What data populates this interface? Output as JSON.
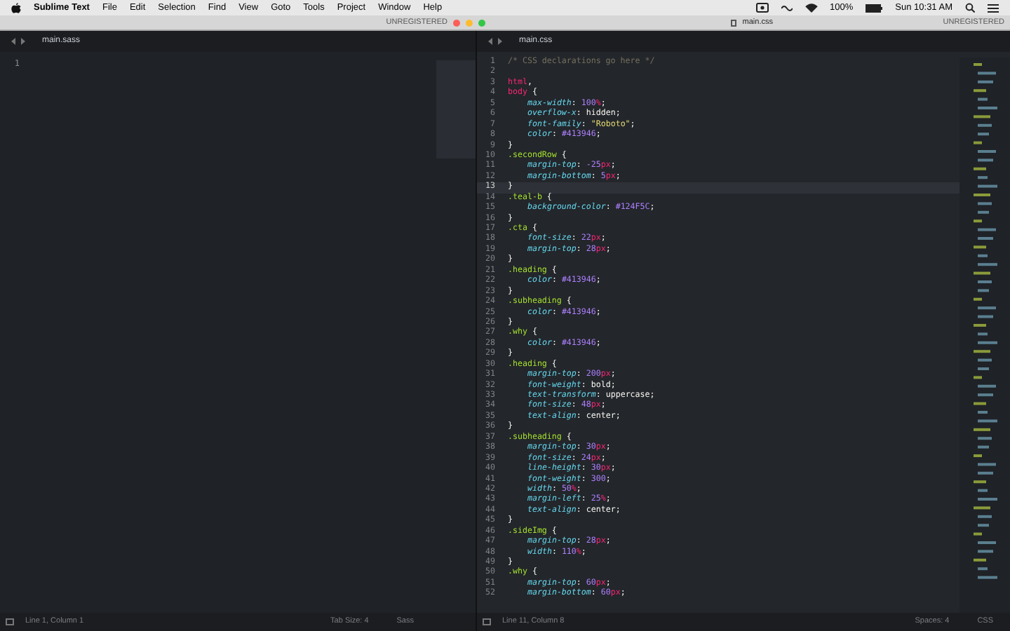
{
  "menu_bar": {
    "app_name": "Sublime Text",
    "menus": [
      "File",
      "Edit",
      "Selection",
      "Find",
      "View",
      "Goto",
      "Tools",
      "Project",
      "Window",
      "Help"
    ],
    "battery": "100%",
    "clock": "Sun 10:31 AM"
  },
  "title_bar": {
    "left_label": "UNREGISTERED",
    "right_title": "main.css",
    "right_label": "UNREGISTERED"
  },
  "left_pane": {
    "tab": "main.sass",
    "line_numbers": [
      "1"
    ],
    "status": {
      "position": "Line 1, Column 1",
      "tab_size": "Tab Size: 4",
      "syntax": "Sass"
    }
  },
  "right_pane": {
    "tab": "main.css",
    "status": {
      "position": "Line 11, Column 8",
      "tab_size": "Spaces: 4",
      "syntax": "CSS"
    },
    "lines": [
      {
        "n": "1",
        "indent": false,
        "current": false,
        "tokens": [
          {
            "text": "/* CSS declarations go here */",
            "kind": "comment"
          }
        ]
      },
      {
        "n": "2",
        "current": false
      },
      {
        "n": "3",
        "indent": false,
        "current": false,
        "tokens": [
          {
            "text": "html",
            "kind": "tag"
          },
          {
            "text": ",",
            "kind": "plain"
          }
        ]
      },
      {
        "n": "4",
        "indent": false,
        "current": false,
        "tokens": [
          {
            "text": "body",
            "kind": "tag"
          },
          {
            "text": " {",
            "kind": "plain"
          }
        ]
      },
      {
        "n": "5",
        "indent": true,
        "current": false,
        "tokens": [
          {
            "text": "max-width",
            "kind": "prop"
          },
          {
            "text": ": ",
            "kind": "plain"
          },
          {
            "text": "100",
            "kind": "num"
          },
          {
            "text": "%",
            "kind": "unit"
          },
          {
            "text": ";",
            "kind": "plain"
          }
        ]
      },
      {
        "n": "6",
        "indent": true,
        "current": false,
        "tokens": [
          {
            "text": "overflow-x",
            "kind": "prop"
          },
          {
            "text": ": hidden;",
            "kind": "plain"
          }
        ]
      },
      {
        "n": "7",
        "indent": true,
        "current": false,
        "tokens": [
          {
            "text": "font-family",
            "kind": "prop"
          },
          {
            "text": ": ",
            "kind": "plain"
          },
          {
            "text": "\"Roboto\"",
            "kind": "string"
          },
          {
            "text": ";",
            "kind": "plain"
          }
        ]
      },
      {
        "n": "8",
        "indent": true,
        "current": false,
        "tokens": [
          {
            "text": "color",
            "kind": "prop"
          },
          {
            "text": ": ",
            "kind": "plain"
          },
          {
            "text": "#413946",
            "kind": "num"
          },
          {
            "text": ";",
            "kind": "plain"
          }
        ]
      },
      {
        "n": "9",
        "indent": false,
        "current": false,
        "tokens": [
          {
            "text": "}",
            "kind": "plain"
          }
        ]
      },
      {
        "n": "10",
        "indent": false,
        "current": false,
        "tokens": [
          {
            "text": ".secondRow",
            "kind": "selector"
          },
          {
            "text": " {",
            "kind": "plain"
          }
        ]
      },
      {
        "n": "11",
        "indent": true,
        "current": false,
        "tokens": [
          {
            "text": "margin-top",
            "kind": "prop"
          },
          {
            "text": ": ",
            "kind": "plain"
          },
          {
            "text": "-25",
            "kind": "num"
          },
          {
            "text": "px",
            "kind": "unit"
          },
          {
            "text": ";",
            "kind": "plain"
          }
        ]
      },
      {
        "n": "12",
        "indent": true,
        "current": false,
        "tokens": [
          {
            "text": "margin-bottom",
            "kind": "prop"
          },
          {
            "text": ": ",
            "kind": "plain"
          },
          {
            "text": "5",
            "kind": "num"
          },
          {
            "text": "px",
            "kind": "unit"
          },
          {
            "text": ";",
            "kind": "plain"
          }
        ]
      },
      {
        "n": "13",
        "indent": false,
        "current": true,
        "tokens": [
          {
            "text": "}",
            "kind": "plain"
          }
        ]
      },
      {
        "n": "14",
        "indent": false,
        "current": false,
        "tokens": [
          {
            "text": ".teal-b",
            "kind": "selector"
          },
          {
            "text": " {",
            "kind": "plain"
          }
        ]
      },
      {
        "n": "15",
        "indent": true,
        "current": false,
        "tokens": [
          {
            "text": "background-color",
            "kind": "prop"
          },
          {
            "text": ": ",
            "kind": "plain"
          },
          {
            "text": "#124F5C",
            "kind": "num"
          },
          {
            "text": ";",
            "kind": "plain"
          }
        ]
      },
      {
        "n": "16",
        "indent": false,
        "current": false,
        "tokens": [
          {
            "text": "}",
            "kind": "plain"
          }
        ]
      },
      {
        "n": "17",
        "indent": false,
        "current": false,
        "tokens": [
          {
            "text": ".cta",
            "kind": "selector"
          },
          {
            "text": " {",
            "kind": "plain"
          }
        ]
      },
      {
        "n": "18",
        "indent": true,
        "current": false,
        "tokens": [
          {
            "text": "font-size",
            "kind": "prop"
          },
          {
            "text": ": ",
            "kind": "plain"
          },
          {
            "text": "22",
            "kind": "num"
          },
          {
            "text": "px",
            "kind": "unit"
          },
          {
            "text": ";",
            "kind": "plain"
          }
        ]
      },
      {
        "n": "19",
        "indent": true,
        "current": false,
        "tokens": [
          {
            "text": "margin-top",
            "kind": "prop"
          },
          {
            "text": ": ",
            "kind": "plain"
          },
          {
            "text": "28",
            "kind": "num"
          },
          {
            "text": "px",
            "kind": "unit"
          },
          {
            "text": ";",
            "kind": "plain"
          }
        ]
      },
      {
        "n": "20",
        "indent": false,
        "current": false,
        "tokens": [
          {
            "text": "}",
            "kind": "plain"
          }
        ]
      },
      {
        "n": "21",
        "indent": false,
        "current": false,
        "tokens": [
          {
            "text": ".heading",
            "kind": "selector"
          },
          {
            "text": " {",
            "kind": "plain"
          }
        ]
      },
      {
        "n": "22",
        "indent": true,
        "current": false,
        "tokens": [
          {
            "text": "color",
            "kind": "prop"
          },
          {
            "text": ": ",
            "kind": "plain"
          },
          {
            "text": "#413946",
            "kind": "num"
          },
          {
            "text": ";",
            "kind": "plain"
          }
        ]
      },
      {
        "n": "23",
        "indent": false,
        "current": false,
        "tokens": [
          {
            "text": "}",
            "kind": "plain"
          }
        ]
      },
      {
        "n": "24",
        "indent": false,
        "current": false,
        "tokens": [
          {
            "text": ".subheading",
            "kind": "selector"
          },
          {
            "text": " {",
            "kind": "plain"
          }
        ]
      },
      {
        "n": "25",
        "indent": true,
        "current": false,
        "tokens": [
          {
            "text": "color",
            "kind": "prop"
          },
          {
            "text": ": ",
            "kind": "plain"
          },
          {
            "text": "#413946",
            "kind": "num"
          },
          {
            "text": ";",
            "kind": "plain"
          }
        ]
      },
      {
        "n": "26",
        "indent": false,
        "current": false,
        "tokens": [
          {
            "text": "}",
            "kind": "plain"
          }
        ]
      },
      {
        "n": "27",
        "indent": false,
        "current": false,
        "tokens": [
          {
            "text": ".why",
            "kind": "selector"
          },
          {
            "text": " {",
            "kind": "plain"
          }
        ]
      },
      {
        "n": "28",
        "indent": true,
        "current": false,
        "tokens": [
          {
            "text": "color",
            "kind": "prop"
          },
          {
            "text": ": ",
            "kind": "plain"
          },
          {
            "text": "#413946",
            "kind": "num"
          },
          {
            "text": ";",
            "kind": "plain"
          }
        ]
      },
      {
        "n": "29",
        "indent": false,
        "current": false,
        "tokens": [
          {
            "text": "}",
            "kind": "plain"
          }
        ]
      },
      {
        "n": "30",
        "indent": false,
        "current": false,
        "tokens": [
          {
            "text": ".heading",
            "kind": "selector"
          },
          {
            "text": " {",
            "kind": "plain"
          }
        ]
      },
      {
        "n": "31",
        "indent": true,
        "current": false,
        "tokens": [
          {
            "text": "margin-top",
            "kind": "prop"
          },
          {
            "text": ": ",
            "kind": "plain"
          },
          {
            "text": "200",
            "kind": "num"
          },
          {
            "text": "px",
            "kind": "unit"
          },
          {
            "text": ";",
            "kind": "plain"
          }
        ]
      },
      {
        "n": "32",
        "indent": true,
        "current": false,
        "tokens": [
          {
            "text": "font-weight",
            "kind": "prop"
          },
          {
            "text": ": bold;",
            "kind": "plain"
          }
        ]
      },
      {
        "n": "33",
        "indent": true,
        "current": false,
        "tokens": [
          {
            "text": "text-transform",
            "kind": "prop"
          },
          {
            "text": ": uppercase;",
            "kind": "plain"
          }
        ]
      },
      {
        "n": "34",
        "indent": true,
        "current": false,
        "tokens": [
          {
            "text": "font-size",
            "kind": "prop"
          },
          {
            "text": ": ",
            "kind": "plain"
          },
          {
            "text": "48",
            "kind": "num"
          },
          {
            "text": "px",
            "kind": "unit"
          },
          {
            "text": ";",
            "kind": "plain"
          }
        ]
      },
      {
        "n": "35",
        "indent": true,
        "current": false,
        "tokens": [
          {
            "text": "text-align",
            "kind": "prop"
          },
          {
            "text": ": center;",
            "kind": "plain"
          }
        ]
      },
      {
        "n": "36",
        "indent": false,
        "current": false,
        "tokens": [
          {
            "text": "}",
            "kind": "plain"
          }
        ]
      },
      {
        "n": "37",
        "indent": false,
        "current": false,
        "tokens": [
          {
            "text": ".subheading",
            "kind": "selector"
          },
          {
            "text": " {",
            "kind": "plain"
          }
        ]
      },
      {
        "n": "38",
        "indent": true,
        "current": false,
        "tokens": [
          {
            "text": "margin-top",
            "kind": "prop"
          },
          {
            "text": ": ",
            "kind": "plain"
          },
          {
            "text": "30",
            "kind": "num"
          },
          {
            "text": "px",
            "kind": "unit"
          },
          {
            "text": ";",
            "kind": "plain"
          }
        ]
      },
      {
        "n": "39",
        "indent": true,
        "current": false,
        "tokens": [
          {
            "text": "font-size",
            "kind": "prop"
          },
          {
            "text": ": ",
            "kind": "plain"
          },
          {
            "text": "24",
            "kind": "num"
          },
          {
            "text": "px",
            "kind": "unit"
          },
          {
            "text": ";",
            "kind": "plain"
          }
        ]
      },
      {
        "n": "40",
        "indent": true,
        "current": false,
        "tokens": [
          {
            "text": "line-height",
            "kind": "prop"
          },
          {
            "text": ": ",
            "kind": "plain"
          },
          {
            "text": "30",
            "kind": "num"
          },
          {
            "text": "px",
            "kind": "unit"
          },
          {
            "text": ";",
            "kind": "plain"
          }
        ]
      },
      {
        "n": "41",
        "indent": true,
        "current": false,
        "tokens": [
          {
            "text": "font-weight",
            "kind": "prop"
          },
          {
            "text": ": ",
            "kind": "plain"
          },
          {
            "text": "300",
            "kind": "num"
          },
          {
            "text": ";",
            "kind": "plain"
          }
        ]
      },
      {
        "n": "42",
        "indent": true,
        "current": false,
        "tokens": [
          {
            "text": "width",
            "kind": "prop"
          },
          {
            "text": ": ",
            "kind": "plain"
          },
          {
            "text": "50",
            "kind": "num"
          },
          {
            "text": "%",
            "kind": "unit"
          },
          {
            "text": ";",
            "kind": "plain"
          }
        ]
      },
      {
        "n": "43",
        "indent": true,
        "current": false,
        "tokens": [
          {
            "text": "margin-left",
            "kind": "prop"
          },
          {
            "text": ": ",
            "kind": "plain"
          },
          {
            "text": "25",
            "kind": "num"
          },
          {
            "text": "%",
            "kind": "unit"
          },
          {
            "text": ";",
            "kind": "plain"
          }
        ]
      },
      {
        "n": "44",
        "indent": true,
        "current": false,
        "tokens": [
          {
            "text": "text-align",
            "kind": "prop"
          },
          {
            "text": ": center;",
            "kind": "plain"
          }
        ]
      },
      {
        "n": "45",
        "indent": false,
        "current": false,
        "tokens": [
          {
            "text": "}",
            "kind": "plain"
          }
        ]
      },
      {
        "n": "46",
        "indent": false,
        "current": false,
        "tokens": [
          {
            "text": ".sideImg",
            "kind": "selector"
          },
          {
            "text": " {",
            "kind": "plain"
          }
        ]
      },
      {
        "n": "47",
        "indent": true,
        "current": false,
        "tokens": [
          {
            "text": "margin-top",
            "kind": "prop"
          },
          {
            "text": ": ",
            "kind": "plain"
          },
          {
            "text": "28",
            "kind": "num"
          },
          {
            "text": "px",
            "kind": "unit"
          },
          {
            "text": ";",
            "kind": "plain"
          }
        ]
      },
      {
        "n": "48",
        "indent": true,
        "current": false,
        "tokens": [
          {
            "text": "width",
            "kind": "prop"
          },
          {
            "text": ": ",
            "kind": "plain"
          },
          {
            "text": "110",
            "kind": "num"
          },
          {
            "text": "%",
            "kind": "unit"
          },
          {
            "text": ";",
            "kind": "plain"
          }
        ]
      },
      {
        "n": "49",
        "indent": false,
        "current": false,
        "tokens": [
          {
            "text": "}",
            "kind": "plain"
          }
        ]
      },
      {
        "n": "50",
        "indent": false,
        "current": false,
        "tokens": [
          {
            "text": ".why",
            "kind": "selector"
          },
          {
            "text": " {",
            "kind": "plain"
          }
        ]
      },
      {
        "n": "51",
        "indent": true,
        "current": false,
        "tokens": [
          {
            "text": "margin-top",
            "kind": "prop"
          },
          {
            "text": ": ",
            "kind": "plain"
          },
          {
            "text": "60",
            "kind": "num"
          },
          {
            "text": "px",
            "kind": "unit"
          },
          {
            "text": ";",
            "kind": "plain"
          }
        ]
      },
      {
        "n": "52",
        "indent": true,
        "current": false,
        "tokens": [
          {
            "text": "margin-bottom",
            "kind": "prop"
          },
          {
            "text": ": ",
            "kind": "plain"
          },
          {
            "text": "60",
            "kind": "num"
          },
          {
            "text": "px",
            "kind": "unit"
          },
          {
            "text": ";",
            "kind": "plain"
          }
        ]
      }
    ]
  }
}
